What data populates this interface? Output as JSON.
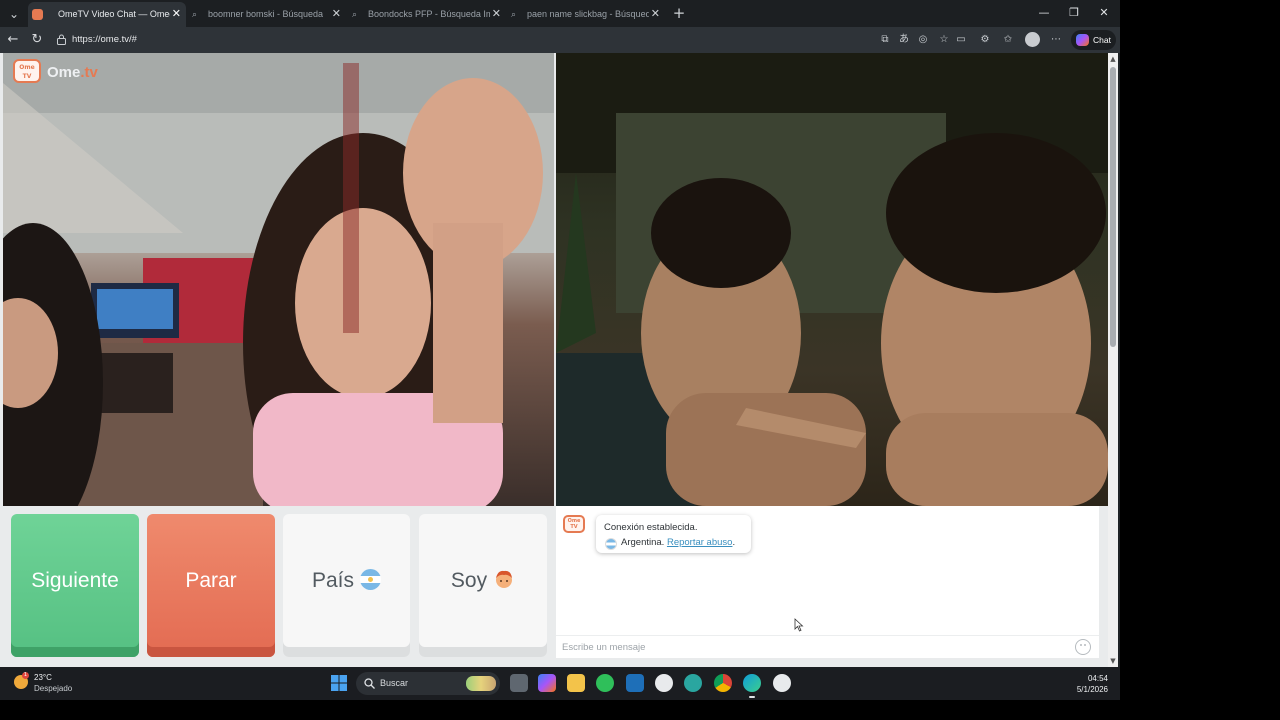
{
  "browser": {
    "tabs": [
      {
        "title": "OmeTV Video Chat — Omegl",
        "active": true
      },
      {
        "title": "boomner bomski - Búsqueda",
        "active": false
      },
      {
        "title": "Boondocks PFP - Búsqueda Imáge",
        "active": false
      },
      {
        "title": "paen name slickbag - Búsqueda I",
        "active": false
      }
    ],
    "url": "https://ome.tv/#",
    "chat_button": "Chat"
  },
  "site": {
    "logo_text": "Ome",
    "logo_suffix": ".tv",
    "logo_badge": "Ome TV"
  },
  "controls": {
    "next": "Siguiente",
    "stop": "Parar",
    "country": "País",
    "gender": "Soy"
  },
  "chat": {
    "status": "Conexión establecida.",
    "country": "Argentina.",
    "report": "Reportar abuso",
    "report_suffix": ".",
    "placeholder": "Escribe un mensaje"
  },
  "taskbar": {
    "temperature": "23°C",
    "condition": "Despejado",
    "weather_badge": "1",
    "search_label": "Buscar",
    "time": "04:54",
    "date": "5/1/2026"
  },
  "colors": {
    "brand": "#e57a52",
    "next_green": "#55c082",
    "stop_red": "#e36b52",
    "link": "#3a8fbf"
  }
}
